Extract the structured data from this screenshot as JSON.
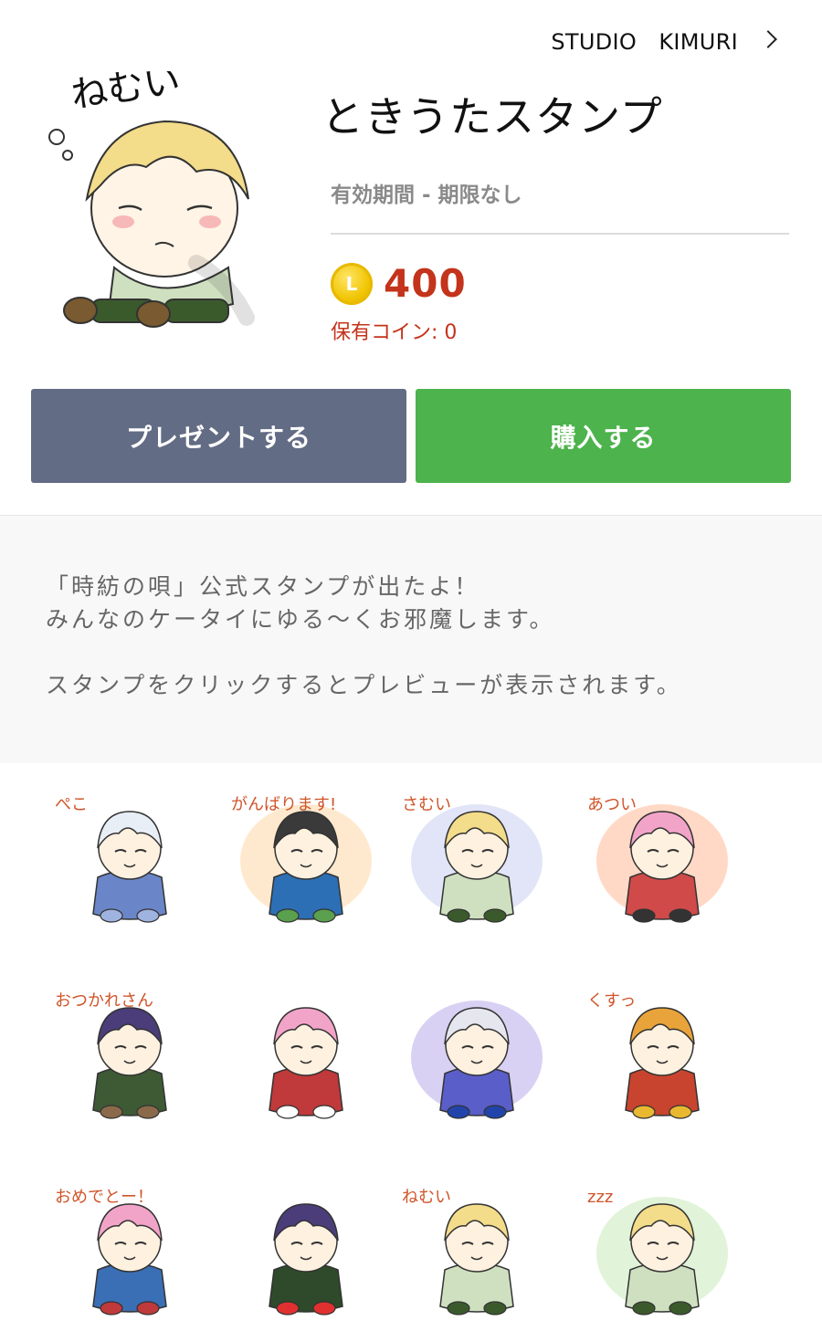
{
  "author": {
    "name": "STUDIO　KIMURI"
  },
  "sticker": {
    "main_image_text": "ねむい",
    "title": "ときうたスタンプ",
    "validity": "有効期間 - 期限なし",
    "coin_letter": "L",
    "price": "400",
    "owned": "保有コイン: 0"
  },
  "buttons": {
    "gift": "プレゼントする",
    "buy": "購入する"
  },
  "description": {
    "line1": "「時紡の唄」公式スタンプが出たよ！",
    "line2": "みんなのケータイにゆる～くお邪魔します。",
    "line3": "スタンプをクリックするとプレビューが表示されます。"
  },
  "stickers": [
    {
      "icon": "bowing-white-hair-girl",
      "caption": "ぺこ",
      "hair": "#e8eef5",
      "body": "#6a86c8",
      "accent": "#9fb3e0",
      "bg": ""
    },
    {
      "icon": "cheering-boy-blue-hat",
      "caption": "がんばります!",
      "hair": "#3a3a3a",
      "body": "#2c6fb5",
      "accent": "#5aa04e",
      "bg": "#ffe3c2"
    },
    {
      "icon": "cold-blond-boy",
      "caption": "さむい",
      "hair": "#f3dc8a",
      "body": "#cfe0c0",
      "accent": "#3b5a2c",
      "bg": "#d9def5"
    },
    {
      "icon": "hot-pink-hair-girl",
      "caption": "あつい",
      "hair": "#f2a4c8",
      "body": "#d04a4a",
      "accent": "#333333",
      "bg": "#ffd0b8"
    },
    {
      "icon": "tired-dark-elf",
      "caption": "おつかれさん",
      "hair": "#4b3d7a",
      "body": "#3d5a35",
      "accent": "#8a6a4a",
      "bg": ""
    },
    {
      "icon": "laughing-pink-girl",
      "caption": "",
      "hair": "#f2a4c8",
      "body": "#c0393b",
      "accent": "#ffffff",
      "bg": ""
    },
    {
      "icon": "sad-white-hair-girl",
      "caption": "",
      "hair": "#e6e6ef",
      "body": "#5a5ec8",
      "accent": "#2244aa",
      "bg": "#cfc6f0"
    },
    {
      "icon": "giggling-orange-girl",
      "caption": "くすっ",
      "hair": "#e8a43a",
      "body": "#c8442e",
      "accent": "#e8b830",
      "bg": ""
    },
    {
      "icon": "celebrating-pair",
      "caption": "おめでとー！",
      "hair": "#f2a4c8",
      "body": "#3a6fb5",
      "accent": "#c0393b",
      "bg": ""
    },
    {
      "icon": "love-dark-elf",
      "caption": "",
      "hair": "#4b3d7a",
      "body": "#2e4a2a",
      "accent": "#e03030",
      "bg": ""
    },
    {
      "icon": "sleepy-blond-boy",
      "caption": "ねむい",
      "hair": "#f3dc8a",
      "body": "#cfe0c0",
      "accent": "#3b5a2c",
      "bg": ""
    },
    {
      "icon": "sleeping-blond-boy",
      "caption": "zzz",
      "hair": "#f3dc8a",
      "body": "#cfe0c0",
      "accent": "#3b5a2c",
      "bg": "#d9f0d0"
    }
  ]
}
